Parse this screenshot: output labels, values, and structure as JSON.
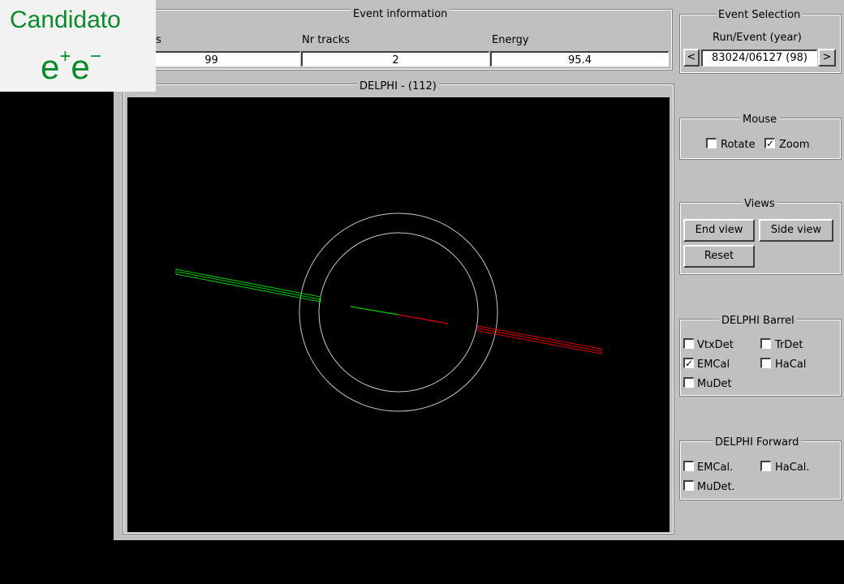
{
  "badge": {
    "title": "Candidato",
    "particle": "e",
    "sup1": "+",
    "particle2": "e",
    "sup2": "−"
  },
  "event_info": {
    "legend": "Event information",
    "col0_header": "s",
    "col1_header": "Nr tracks",
    "col2_header": "Energy",
    "col0_value": "99",
    "col1_value": "2",
    "col2_value": "95.4"
  },
  "display": {
    "legend": "DELPHI - (112)"
  },
  "event_selection": {
    "legend": "Event Selection",
    "label": "Run/Event  (year)",
    "prev": "<",
    "value": "83024/06127  (98)",
    "next": ">"
  },
  "mouse": {
    "legend": "Mouse",
    "rotate_label": "Rotate",
    "rotate_checked": "",
    "zoom_label": "Zoom",
    "zoom_checked": "✓"
  },
  "views": {
    "legend": "Views",
    "end_view": "End view",
    "side_view": "Side view",
    "reset": "Reset"
  },
  "barrel": {
    "legend": "DELPHI Barrel",
    "vtxdet": "VtxDet",
    "vtxdet_checked": "",
    "trdet": "TrDet",
    "trdet_checked": "",
    "emcal": "EMCal",
    "emcal_checked": "✓",
    "hacal": "HaCal",
    "hacal_checked": "",
    "mudet": "MuDet",
    "mudet_checked": ""
  },
  "forward": {
    "legend": "DELPHI Forward",
    "emcal": "EMCal.",
    "emcal_checked": "",
    "hacal": "HaCal.",
    "hacal_checked": "",
    "mudet": "MuDet.",
    "mudet_checked": ""
  },
  "colors": {
    "track_left": "#00cc00",
    "track_right": "#dd0000",
    "detector": "#c8c8c8"
  }
}
